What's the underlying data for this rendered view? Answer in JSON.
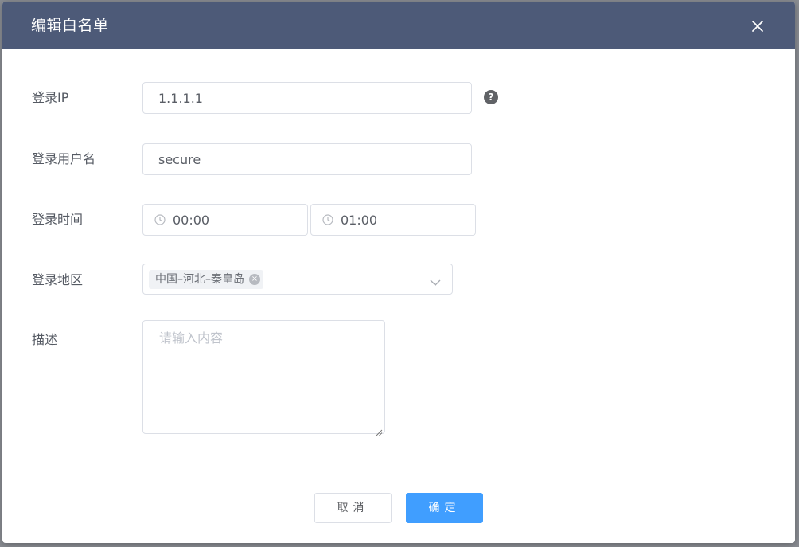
{
  "dialog": {
    "title": "编辑白名单",
    "close_icon": "close-icon"
  },
  "form": {
    "login_ip": {
      "label": "登录IP",
      "value": "1.1.1.1",
      "help_icon": "question-circle-icon",
      "help_glyph": "?"
    },
    "login_user": {
      "label": "登录用户名",
      "value": "secure"
    },
    "login_time": {
      "label": "登录时间",
      "start": "00:00",
      "end": "01:00",
      "icon": "clock-icon"
    },
    "login_region": {
      "label": "登录地区",
      "tag": "中国–河北–秦皇岛",
      "tag_close_glyph": "×",
      "dropdown_icon": "chevron-down-icon"
    },
    "description": {
      "label": "描述",
      "placeholder": "请输入内容"
    }
  },
  "footer": {
    "cancel_label": "取消",
    "ok_label": "确定"
  },
  "colors": {
    "header": "#4d5a78",
    "primary": "#409eff",
    "overlay": "#8a8d93"
  }
}
